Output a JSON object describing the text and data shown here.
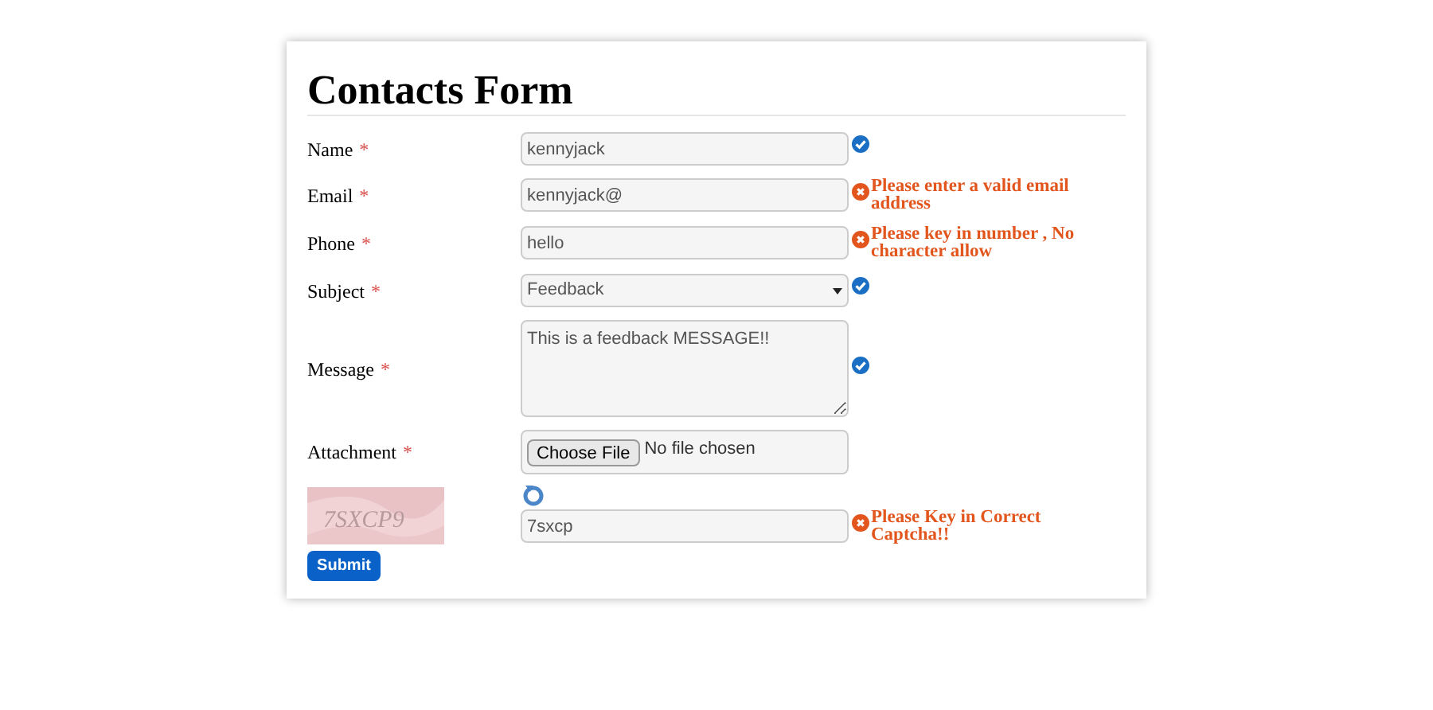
{
  "title": "Contacts Form",
  "fields": [
    {
      "kind": "text",
      "label": "Name",
      "required_mark": "*",
      "value": "kennyjack",
      "valid": true
    },
    {
      "kind": "text",
      "label": "Email",
      "required_mark": "*",
      "value": "kennyjack@",
      "valid": false,
      "error": "Please enter a valid email address"
    },
    {
      "kind": "text",
      "label": "Phone",
      "required_mark": "*",
      "value": "hello",
      "valid": false,
      "error": "Please key in number , No character allow"
    },
    {
      "kind": "select",
      "label": "Subject",
      "required_mark": "*",
      "value": "Feedback",
      "valid": true
    },
    {
      "kind": "textarea",
      "label": "Message",
      "required_mark": "*",
      "value": "This is a feedback MESSAGE!!",
      "valid": true
    },
    {
      "kind": "file",
      "label": "Attachment",
      "required_mark": "*",
      "button": "Choose File",
      "value": "No file chosen"
    }
  ],
  "captcha": {
    "code": "7SXCP9",
    "value": "7sxcp",
    "valid": false,
    "error": "Please Key in Correct Captcha!!"
  },
  "submit": "Submit"
}
